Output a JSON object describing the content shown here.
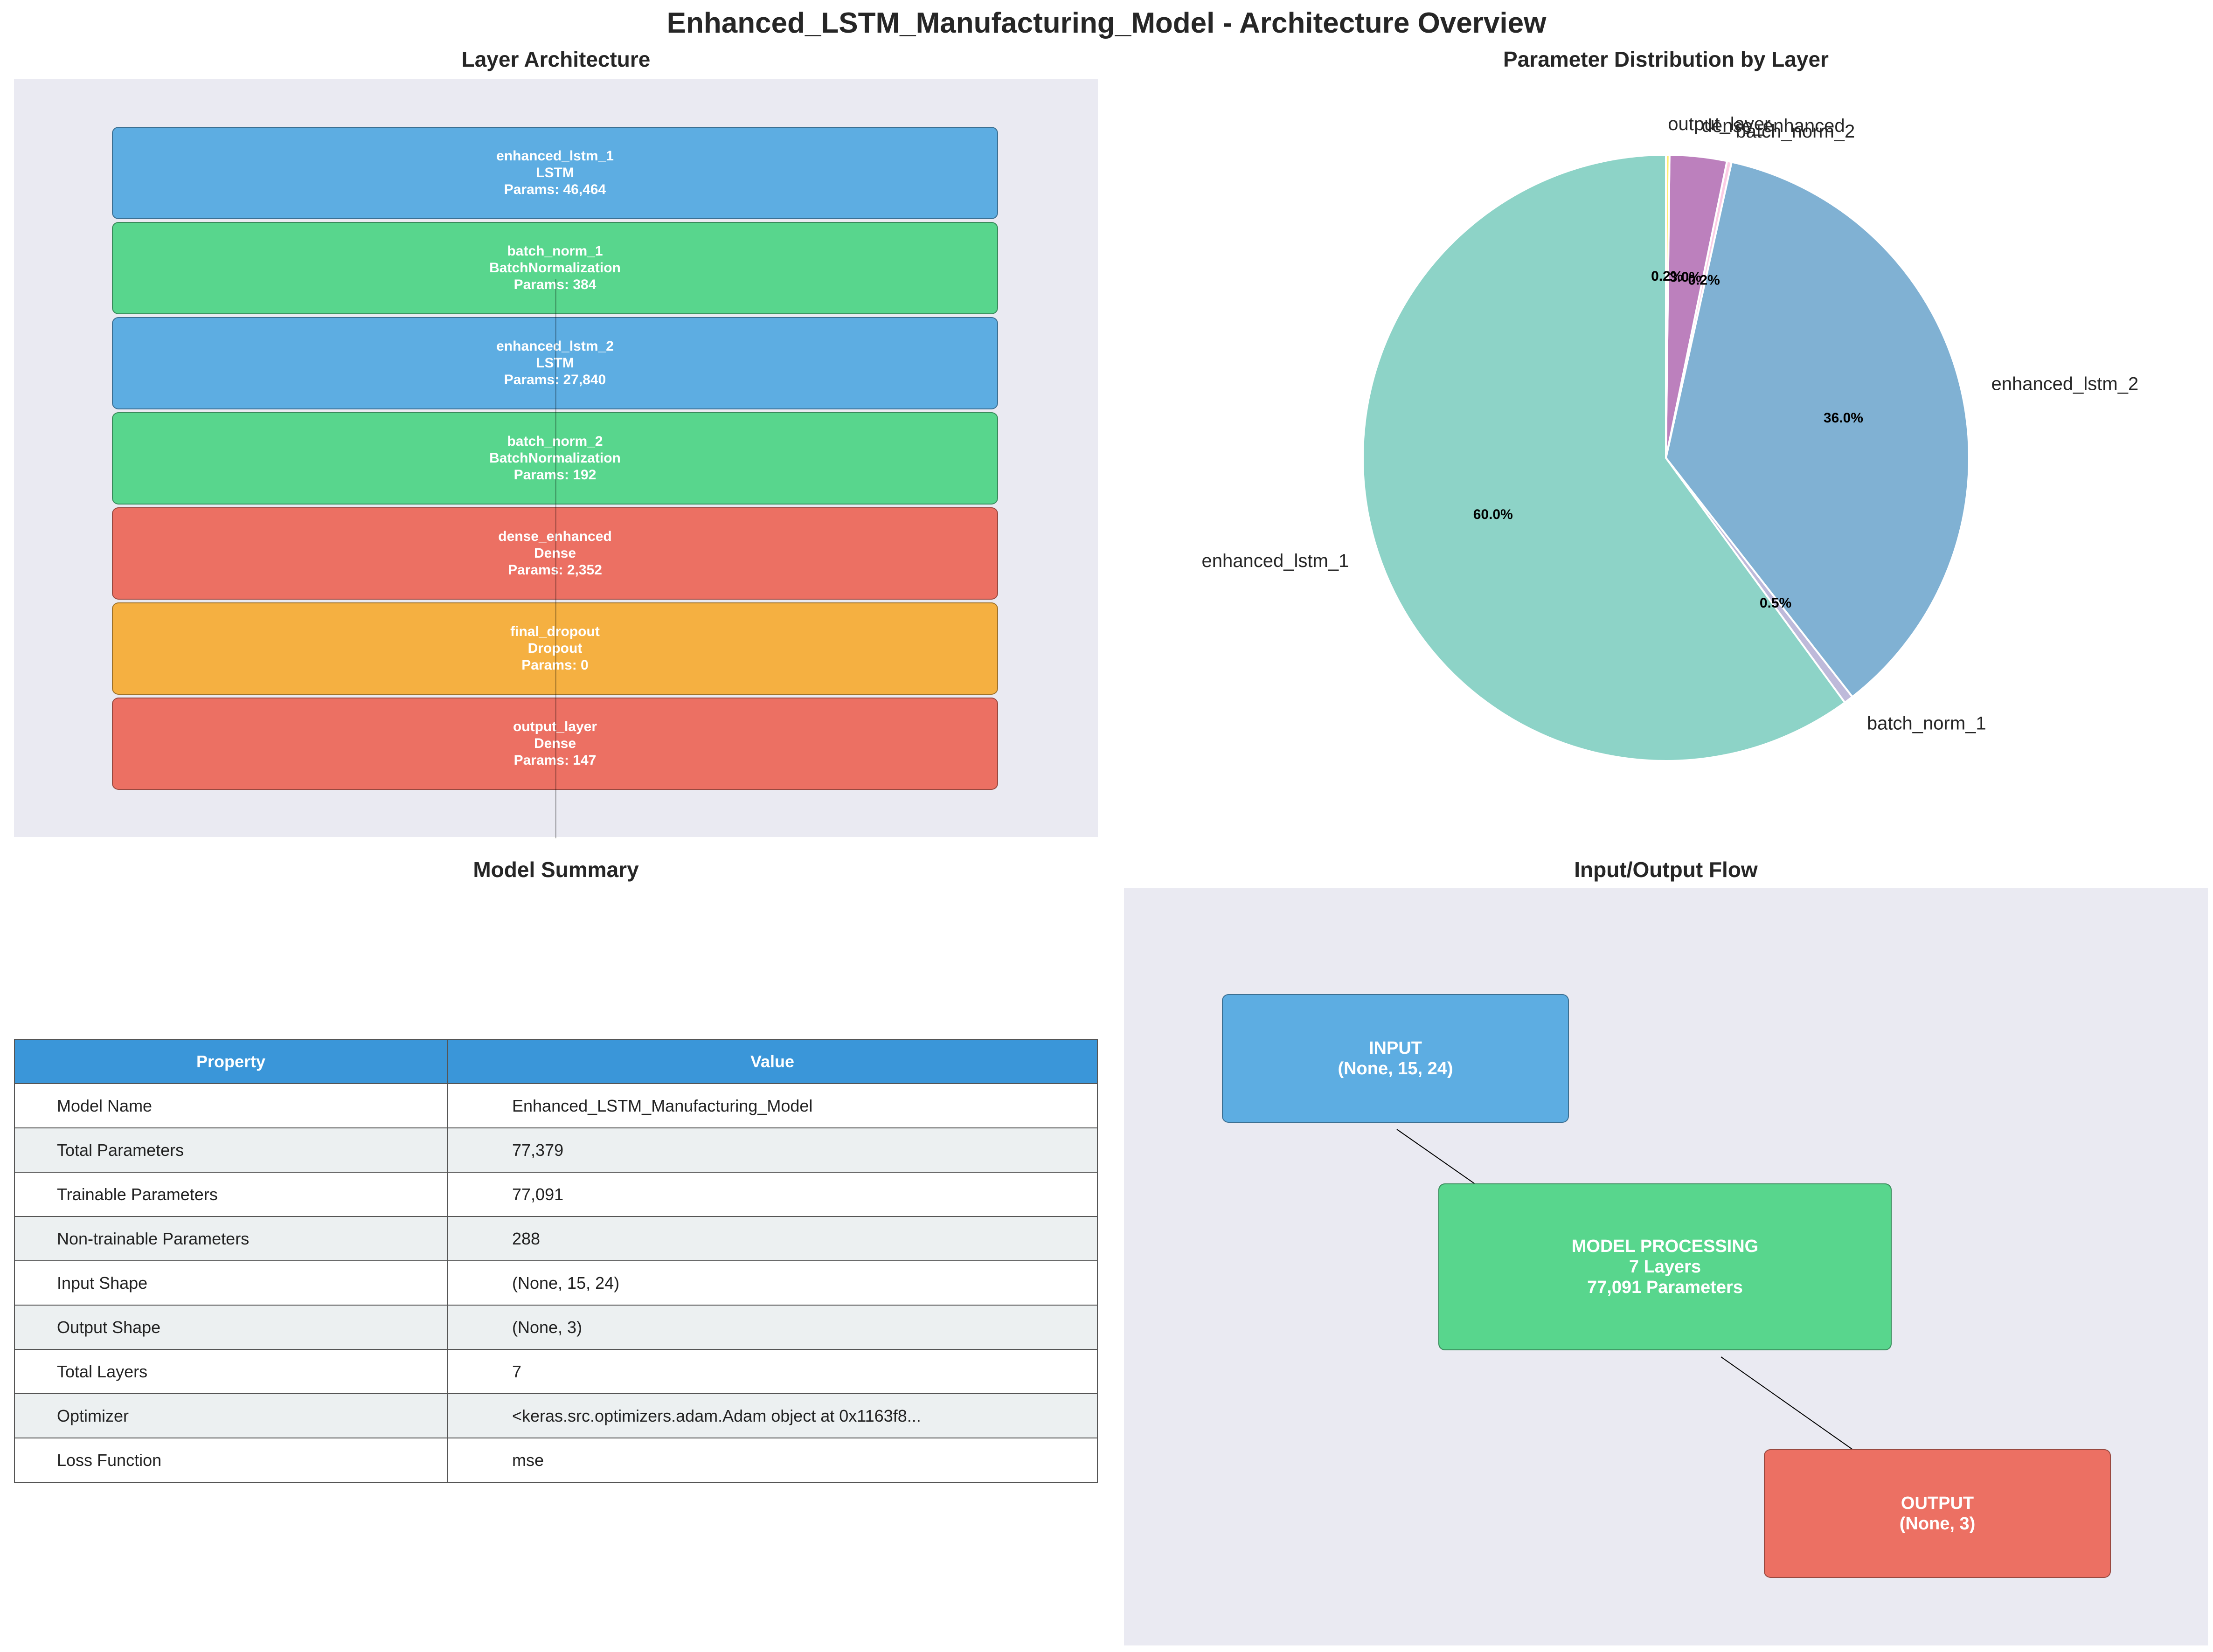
{
  "title": "Enhanced_LSTM_Manufacturing_Model - Architecture Overview",
  "layer_architecture": {
    "title": "Layer Architecture",
    "layers": [
      {
        "name": "enhanced_lstm_1",
        "type": "LSTM",
        "params": "Params: 46,464",
        "color": "#5dade2"
      },
      {
        "name": "batch_norm_1",
        "type": "BatchNormalization",
        "params": "Params: 384",
        "color": "#58d68d"
      },
      {
        "name": "enhanced_lstm_2",
        "type": "LSTM",
        "params": "Params: 27,840",
        "color": "#5dade2"
      },
      {
        "name": "batch_norm_2",
        "type": "BatchNormalization",
        "params": "Params: 192",
        "color": "#58d68d"
      },
      {
        "name": "dense_enhanced",
        "type": "Dense",
        "params": "Params: 2,352",
        "color": "#ec7063"
      },
      {
        "name": "final_dropout",
        "type": "Dropout",
        "params": "Params: 0",
        "color": "#f5b041"
      },
      {
        "name": "output_layer",
        "type": "Dense",
        "params": "Params: 147",
        "color": "#ec7063"
      }
    ]
  },
  "param_distribution": {
    "title": "Parameter Distribution by Layer"
  },
  "chart_data": {
    "type": "pie",
    "title": "Parameter Distribution by Layer",
    "start_angle_deg": 90,
    "slices": [
      {
        "label": "enhanced_lstm_1",
        "value": 46464,
        "pct_label": "60.0%",
        "color": "#8dd3c7"
      },
      {
        "label": "batch_norm_1",
        "value": 384,
        "pct_label": "0.5%",
        "color": "#bebada"
      },
      {
        "label": "enhanced_lstm_2",
        "value": 27840,
        "pct_label": "36.0%",
        "color": "#80b1d3"
      },
      {
        "label": "batch_norm_2",
        "value": 192,
        "pct_label": "0.2%",
        "color": "#fccde5"
      },
      {
        "label": "dense_enhanced",
        "value": 2352,
        "pct_label": "3.0%",
        "color": "#bc80bd"
      },
      {
        "label": "output_layer",
        "value": 147,
        "pct_label": "0.2%",
        "color": "#ffed6f"
      }
    ]
  },
  "model_summary": {
    "title": "Model Summary",
    "headers": [
      "Property",
      "Value"
    ],
    "rows": [
      [
        "Model Name",
        "Enhanced_LSTM_Manufacturing_Model"
      ],
      [
        "Total Parameters",
        "77,379"
      ],
      [
        "Trainable Parameters",
        "77,091"
      ],
      [
        "Non-trainable Parameters",
        "288"
      ],
      [
        "Input Shape",
        "(None, 15, 24)"
      ],
      [
        "Output Shape",
        "(None, 3)"
      ],
      [
        "Total Layers",
        "7"
      ],
      [
        "Optimizer",
        "<keras.src.optimizers.adam.Adam object at 0x1163f8..."
      ],
      [
        "Loss Function",
        "mse"
      ]
    ]
  },
  "io_flow": {
    "title": "Input/Output Flow",
    "input": {
      "line1": "INPUT",
      "line2": "(None, 15, 24)",
      "color": "#5dade2"
    },
    "model": {
      "line1": "MODEL PROCESSING",
      "line2": "7 Layers",
      "line3": "77,091 Parameters",
      "color": "#58d68d"
    },
    "output": {
      "line1": "OUTPUT",
      "line2": "(None, 3)",
      "color": "#ec7063"
    }
  }
}
